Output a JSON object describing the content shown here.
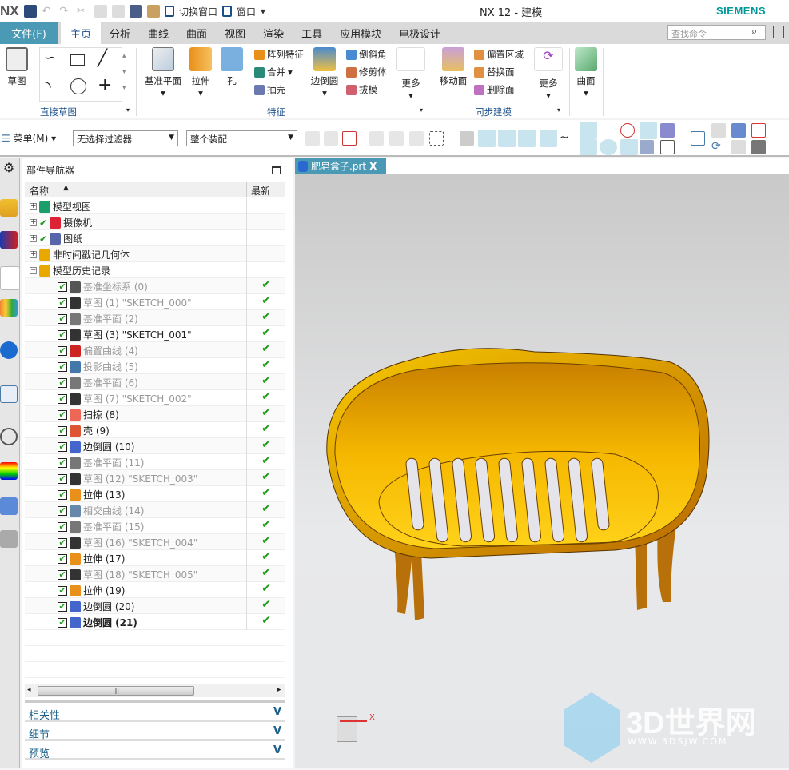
{
  "app": {
    "logo": "NX",
    "title": "NX 12 - 建模",
    "brand": "SIEMENS",
    "switch_window": "切换窗口",
    "window": "窗口"
  },
  "tabs": [
    {
      "label": "文件(F)"
    },
    {
      "label": "主页"
    },
    {
      "label": "分析"
    },
    {
      "label": "曲线"
    },
    {
      "label": "曲面"
    },
    {
      "label": "视图"
    },
    {
      "label": "渲染"
    },
    {
      "label": "工具"
    },
    {
      "label": "应用模块"
    },
    {
      "label": "电极设计"
    }
  ],
  "search": {
    "placeholder": "查找命令"
  },
  "ribbon": {
    "sketch": "草图",
    "group1": "直接草图",
    "datum_plane": "基准平面",
    "extrude": "拉伸",
    "hole": "孔",
    "pattern": "阵列特征",
    "unite": "合并",
    "shell": "抽壳",
    "edge_blend": "边倒圆",
    "chamfer": "倒斜角",
    "trim_body": "修剪体",
    "draft": "拔模",
    "more1": "更多",
    "group2": "特征",
    "move_face": "移动面",
    "offset_region": "偏置区域",
    "replace_face": "替换面",
    "delete_face": "删除面",
    "more2": "更多",
    "group3": "同步建模",
    "surface": "曲面"
  },
  "toolbar": {
    "menu": "菜单(M)",
    "filter": "无选择过滤器",
    "assembly": "整个装配"
  },
  "navigator": {
    "title": "部件导航器",
    "col_name": "名称",
    "col_latest": "最新",
    "rows": [
      {
        "label": "模型视图",
        "level": 0,
        "expand": "+",
        "check": false,
        "style": "normal",
        "icon": "model-views-icon",
        "color": "#1a9e6a",
        "latest": ""
      },
      {
        "label": "摄像机",
        "level": 0,
        "expand": "+",
        "check": "tick",
        "style": "normal",
        "icon": "camera-icon",
        "color": "#d23",
        "latest": ""
      },
      {
        "label": "图纸",
        "level": 0,
        "expand": "+",
        "check": "tick",
        "style": "normal",
        "icon": "drawing-icon",
        "color": "#56a",
        "latest": ""
      },
      {
        "label": "非时间戳记几何体",
        "level": 0,
        "expand": "+",
        "check": false,
        "style": "normal",
        "icon": "folder-icon",
        "color": "#e9a800",
        "latest": ""
      },
      {
        "label": "模型历史记录",
        "level": 0,
        "expand": "−",
        "check": false,
        "style": "normal",
        "icon": "folder-open-icon",
        "color": "#e9a800",
        "latest": ""
      },
      {
        "label": "基准坐标系 (0)",
        "level": 1,
        "check": true,
        "style": "gray",
        "icon": "datum-csys-icon",
        "color": "#555",
        "latest": "✔"
      },
      {
        "label": "草图 (1) \"SKETCH_000\"",
        "level": 1,
        "check": true,
        "style": "gray",
        "icon": "sketch-icon",
        "color": "#333",
        "latest": "✔"
      },
      {
        "label": "基准平面 (2)",
        "level": 1,
        "check": true,
        "style": "gray",
        "icon": "datum-plane-icon",
        "color": "#777",
        "latest": "✔"
      },
      {
        "label": "草图 (3) \"SKETCH_001\"",
        "level": 1,
        "check": true,
        "style": "normal",
        "icon": "sketch-icon",
        "color": "#333",
        "latest": "✔"
      },
      {
        "label": "偏置曲线 (4)",
        "level": 1,
        "check": true,
        "style": "gray",
        "icon": "offset-curve-icon",
        "color": "#c22",
        "latest": "✔"
      },
      {
        "label": "投影曲线 (5)",
        "level": 1,
        "check": true,
        "style": "gray",
        "icon": "project-curve-icon",
        "color": "#47a",
        "latest": "✔"
      },
      {
        "label": "基准平面 (6)",
        "level": 1,
        "check": true,
        "style": "gray",
        "icon": "datum-plane-icon",
        "color": "#777",
        "latest": "✔"
      },
      {
        "label": "草图 (7) \"SKETCH_002\"",
        "level": 1,
        "check": true,
        "style": "gray",
        "icon": "sketch-icon",
        "color": "#333",
        "latest": "✔"
      },
      {
        "label": "扫掠 (8)",
        "level": 1,
        "check": true,
        "style": "normal",
        "icon": "sweep-icon",
        "color": "#e65",
        "latest": "✔"
      },
      {
        "label": "壳 (9)",
        "level": 1,
        "check": true,
        "style": "normal",
        "icon": "shell-icon",
        "color": "#d53",
        "latest": "✔"
      },
      {
        "label": "边倒圆 (10)",
        "level": 1,
        "check": true,
        "style": "normal",
        "icon": "edge-blend-icon",
        "color": "#46c",
        "latest": "✔"
      },
      {
        "label": "基准平面 (11)",
        "level": 1,
        "check": true,
        "style": "gray",
        "icon": "datum-plane-icon",
        "color": "#777",
        "latest": "✔"
      },
      {
        "label": "草图 (12) \"SKETCH_003\"",
        "level": 1,
        "check": true,
        "style": "gray",
        "icon": "sketch-icon",
        "color": "#333",
        "latest": "✔"
      },
      {
        "label": "拉伸 (13)",
        "level": 1,
        "check": true,
        "style": "normal",
        "icon": "extrude-icon",
        "color": "#e8901a",
        "latest": "✔"
      },
      {
        "label": "相交曲线 (14)",
        "level": 1,
        "check": true,
        "style": "gray",
        "icon": "intersection-curve-icon",
        "color": "#68a",
        "latest": "✔"
      },
      {
        "label": "基准平面 (15)",
        "level": 1,
        "check": true,
        "style": "gray",
        "icon": "datum-plane-icon",
        "color": "#777",
        "latest": "✔"
      },
      {
        "label": "草图 (16) \"SKETCH_004\"",
        "level": 1,
        "check": true,
        "style": "gray",
        "icon": "sketch-icon",
        "color": "#333",
        "latest": "✔"
      },
      {
        "label": "拉伸 (17)",
        "level": 1,
        "check": true,
        "style": "normal",
        "icon": "extrude-icon",
        "color": "#e8901a",
        "latest": "✔"
      },
      {
        "label": "草图 (18) \"SKETCH_005\"",
        "level": 1,
        "check": true,
        "style": "gray",
        "icon": "sketch-icon",
        "color": "#333",
        "latest": "✔"
      },
      {
        "label": "拉伸 (19)",
        "level": 1,
        "check": true,
        "style": "normal",
        "icon": "extrude-icon",
        "color": "#e8901a",
        "latest": "✔"
      },
      {
        "label": "边倒圆 (20)",
        "level": 1,
        "check": true,
        "style": "normal",
        "icon": "edge-blend-icon",
        "color": "#46c",
        "latest": "✔"
      },
      {
        "label": "边倒圆 (21)",
        "level": 1,
        "check": true,
        "style": "bold",
        "icon": "edge-blend-icon",
        "color": "#46c",
        "latest": "✔"
      }
    ],
    "panels": [
      "相关性",
      "细节",
      "预览"
    ]
  },
  "document": {
    "tab": "肥皂盒子.prt",
    "close": "X"
  },
  "triad": {
    "x": "X"
  },
  "watermark": {
    "name": "3D世界网",
    "url": "WWW.3DSJW.COM"
  },
  "colors": {
    "accent": "#4b9ab5",
    "model": "#f0b000",
    "check": "#1a9e1a"
  }
}
